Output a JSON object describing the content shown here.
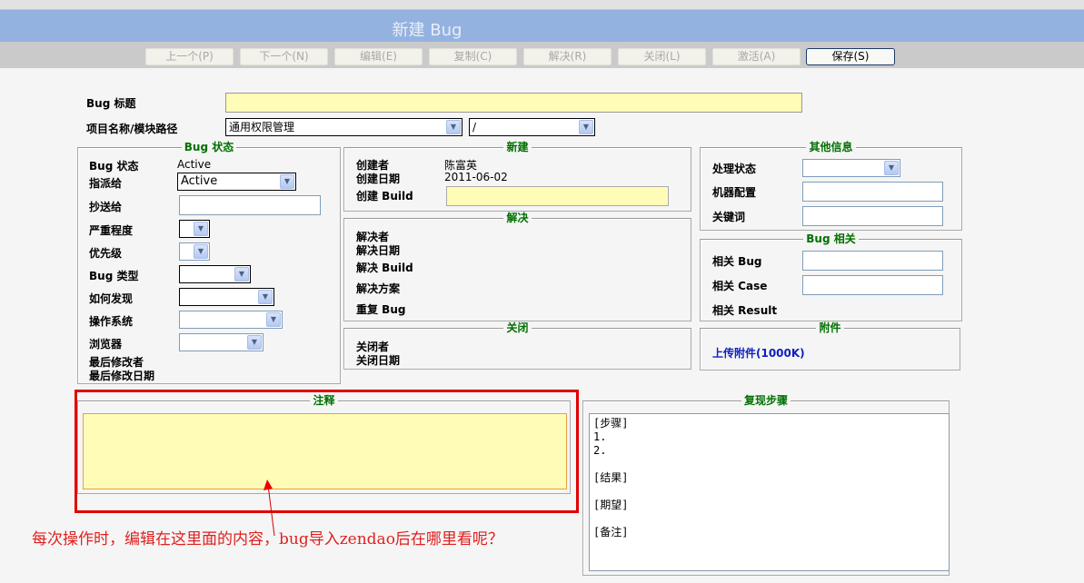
{
  "header": {
    "title": "新建 Bug"
  },
  "toolbar": [
    {
      "label": "上一个(P)",
      "enabled": false
    },
    {
      "label": "下一个(N)",
      "enabled": false
    },
    {
      "label": "编辑(E)",
      "enabled": false
    },
    {
      "label": "复制(C)",
      "enabled": false
    },
    {
      "label": "解决(R)",
      "enabled": false
    },
    {
      "label": "关闭(L)",
      "enabled": false
    },
    {
      "label": "激活(A)",
      "enabled": false
    },
    {
      "label": "保存(S)",
      "enabled": true
    }
  ],
  "form": {
    "title_label": "Bug 标题",
    "title_value": "",
    "project_label": "项目名称/模块路径",
    "project_value": "通用权限管理",
    "module_value": "/"
  },
  "status": {
    "legend": "Bug 状态",
    "status_label": "Bug 状态",
    "status_value": "Active",
    "assign_label": "指派给",
    "assign_value": "Active",
    "cc_label": "抄送给",
    "severity_label": "严重程度",
    "priority_label": "优先级",
    "type_label": "Bug 类型",
    "how_label": "如何发现",
    "os_label": "操作系统",
    "browser_label": "浏览器",
    "last_editor_label": "最后修改者",
    "last_date_label": "最后修改日期"
  },
  "created": {
    "legend": "新建",
    "creator_label": "创建者",
    "creator_value": "陈富英",
    "date_label": "创建日期",
    "date_value": "2011-06-02",
    "build_label": "创建 Build"
  },
  "resolve": {
    "legend": "解决",
    "resolver_label": "解决者",
    "date_label": "解决日期",
    "build_label": "解决 Build",
    "solution_label": "解决方案",
    "duplicate_label": "重复 Bug"
  },
  "close": {
    "legend": "关闭",
    "closer_label": "关闭者",
    "date_label": "关闭日期"
  },
  "other": {
    "legend": "其他信息",
    "state_label": "处理状态",
    "machine_label": "机器配置",
    "keyword_label": "关键词"
  },
  "related": {
    "legend": "Bug 相关",
    "bug_label": "相关 Bug",
    "case_label": "相关 Case",
    "result_label": "相关 Result"
  },
  "attach": {
    "legend": "附件",
    "upload_link": "上传附件(1000K)"
  },
  "notes": {
    "legend": "注释",
    "value": ""
  },
  "steps": {
    "legend": "复现步骤",
    "value": "[步骤]\n1.\n2.\n\n[结果]\n\n[期望]\n\n[备注]"
  },
  "annotation": {
    "text": "每次操作时，编辑在这里面的内容，bug导入zendao后在哪里看呢？"
  }
}
